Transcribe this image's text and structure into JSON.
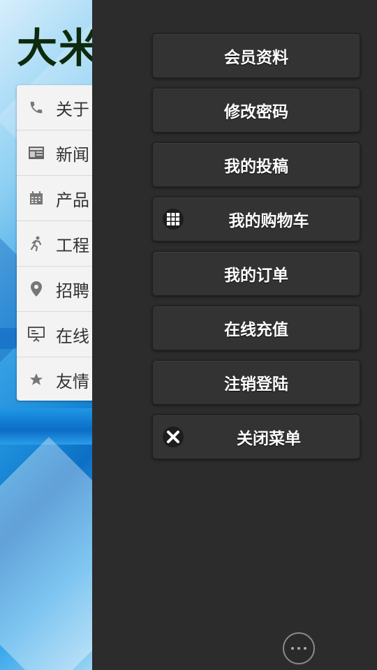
{
  "site": {
    "title": "大米"
  },
  "side_menu": {
    "items": [
      {
        "label": "关于",
        "icon": "phone-icon"
      },
      {
        "label": "新闻",
        "icon": "newspaper-icon"
      },
      {
        "label": "产品",
        "icon": "calendar-icon"
      },
      {
        "label": "工程",
        "icon": "runner-icon"
      },
      {
        "label": "招聘",
        "icon": "location-pin-icon"
      },
      {
        "label": "在线",
        "icon": "presentation-icon"
      },
      {
        "label": "友情",
        "icon": "star-icon"
      }
    ]
  },
  "drawer": {
    "buttons": [
      {
        "label": "会员资料"
      },
      {
        "label": "修改密码"
      },
      {
        "label": "我的投稿"
      },
      {
        "label": "我的购物车",
        "icon": "grid-icon"
      },
      {
        "label": "我的订单"
      },
      {
        "label": "在线充值"
      },
      {
        "label": "注销登陆"
      },
      {
        "label": "关闭菜单",
        "icon": "close-icon"
      }
    ]
  },
  "colors": {
    "drawer_bg": "#2c2c2c",
    "button_bg": "#333333",
    "button_text": "#ffffff",
    "title_text": "#0e2a0c"
  }
}
